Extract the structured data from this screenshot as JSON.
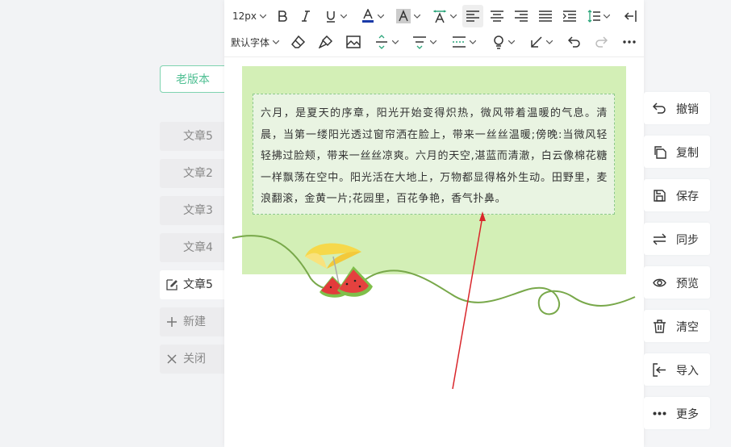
{
  "sidebar": {
    "old_version": "老版本",
    "items": [
      {
        "label": "文章5"
      },
      {
        "label": "文章2"
      },
      {
        "label": "文章3"
      },
      {
        "label": "文章4"
      },
      {
        "label": "文章5"
      }
    ],
    "new_label": "新建",
    "close_label": "关闭"
  },
  "toolbar": {
    "font_size": "12px",
    "font_family": "默认字体"
  },
  "content": {
    "text": "六月，是夏天的序章，阳光开始变得炽热，微风带着温暖的气息。清晨，当第一缕阳光透过窗帘洒在脸上，带来一丝丝温暖;傍晚:当微风轻轻拂过脸颊，带来一丝丝凉爽。六月的天空,湛蓝而清澈，白云像棉花糖一样飘荡在空中。阳光活在大地上，万物都显得格外生动。田野里，麦浪翻滚，金黄一片;花园里，百花争艳，香气扑鼻。"
  },
  "actions": {
    "undo": "撤销",
    "copy": "复制",
    "save": "保存",
    "sync": "同步",
    "preview": "预览",
    "clear": "清空",
    "import": "导入",
    "more": "更多"
  },
  "colors": {
    "accent": "#4fbf93",
    "canvas_bg": "#d3efb6",
    "font_color_bar": "#1a3aa8",
    "arrow": "#d9262b"
  }
}
